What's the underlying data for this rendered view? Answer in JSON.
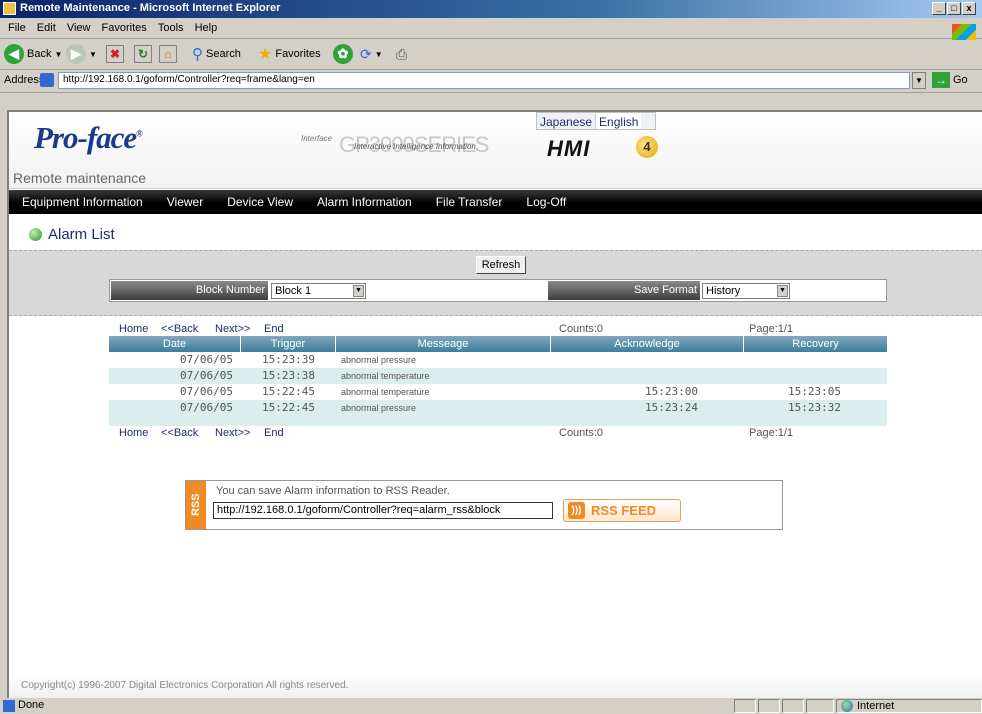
{
  "window": {
    "title": "Remote Maintenance - Microsoft Internet Explorer",
    "buttons": [
      "_",
      "□",
      "x"
    ]
  },
  "menu": [
    "File",
    "Edit",
    "View",
    "Favorites",
    "Tools",
    "Help"
  ],
  "toolbar": {
    "back": "Back",
    "search": "Search",
    "favorites": "Favorites"
  },
  "address": {
    "label": "Address",
    "url": "http://192.168.0.1/goform/Controller?req=frame&lang=en",
    "go": "Go"
  },
  "header": {
    "brand": "Pro-face",
    "brand_mark": "®",
    "lang_japanese": "Japanese",
    "lang_english": "English",
    "gp_interface": "Interface",
    "gp_logo": "GP3000SERIES",
    "gp_tagline": "Interactive Intelligence Information",
    "hmi": "HMI",
    "hmi_num": "4",
    "subtitle": "Remote maintenance"
  },
  "nav": [
    "Equipment Information",
    "Viewer",
    "Device View",
    "Alarm Information",
    "File Transfer",
    "Log-Off"
  ],
  "page": {
    "title": "Alarm List"
  },
  "controls": {
    "refresh": "Refresh",
    "block_label": "Block Number",
    "block_value": "Block 1",
    "save_label": "Save Format",
    "save_value": "History"
  },
  "table_nav": {
    "home": "Home",
    "back": "<<Back",
    "next": "Next>>",
    "end": "End",
    "counts": "Counts:0",
    "page": "Page:1/1"
  },
  "columns": [
    "Date",
    "Trigger",
    "Messeage",
    "Acknowledge",
    "Recovery"
  ],
  "rows": [
    [
      "07/06/05",
      "15:23:39",
      "abnormal pressure",
      "",
      ""
    ],
    [
      "07/06/05",
      "15:23:38",
      "abnormal temperature",
      "",
      ""
    ],
    [
      "07/06/05",
      "15:22:45",
      "abnormal temperature",
      "15:23:00",
      "15:23:05"
    ],
    [
      "07/06/05",
      "15:22:45",
      "abnormal pressure",
      "15:23:24",
      "15:23:32"
    ]
  ],
  "rss": {
    "tab": "RSS",
    "text": "You can save Alarm information to RSS Reader.",
    "url": "http://192.168.0.1/goform/Controller?req=alarm_rss&block",
    "button": "RSS FEED"
  },
  "footer": {
    "copyright": "Copyright(c) 1996-2007 Digital Electronics Corporation All rights reserved."
  },
  "status": {
    "text": "Done",
    "zone": "Internet"
  }
}
